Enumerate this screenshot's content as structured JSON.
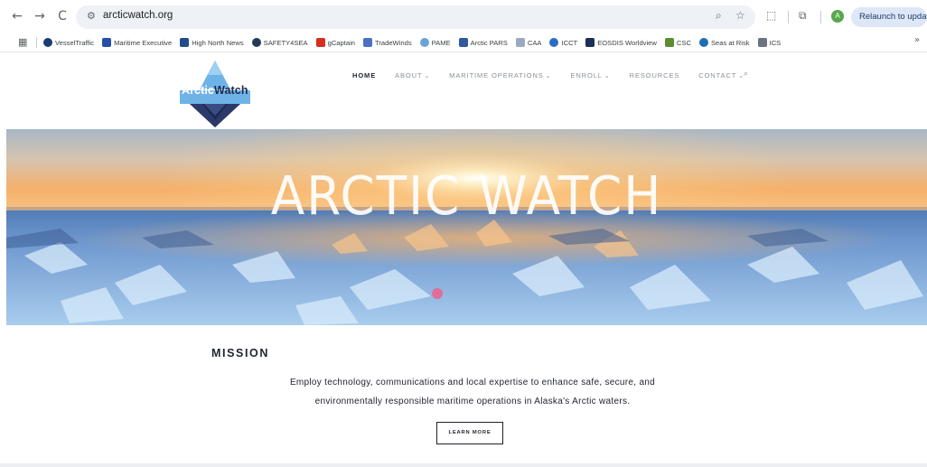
{
  "browser": {
    "nav": {
      "back": "←",
      "forward": "→",
      "reload": "C"
    },
    "site_info_icon": "tune-icon",
    "url": "arcticwatch.org",
    "toolbar_icons": [
      "zoom-icon",
      "bookmark-star-icon",
      "extensions-icon",
      "tab-search-icon"
    ],
    "avatar_letter": "A",
    "relaunch_label": "Relaunch to update",
    "bookmarks": [
      {
        "label": "VesselTraffic",
        "color": "#1d3b73"
      },
      {
        "label": "Maritime Executive",
        "color": "#2650a6"
      },
      {
        "label": "High North News",
        "color": "#1f4f86"
      },
      {
        "label": "SAFETY4SEA",
        "color": "#243b55"
      },
      {
        "label": "gCaptain",
        "color": "#d4301f"
      },
      {
        "label": "TradeWinds",
        "color": "#4a72c4"
      },
      {
        "label": "PAME",
        "color": "#6aa3d6"
      },
      {
        "label": "Arctic PARS",
        "color": "#2f5a9e"
      },
      {
        "label": "CAA",
        "color": "#9aa8c2"
      },
      {
        "label": "ICCT",
        "color": "#2a6cc4"
      },
      {
        "label": "EOSDIS Worldview",
        "color": "#1b2f57"
      },
      {
        "label": "CSC",
        "color": "#5e8c32"
      },
      {
        "label": "Seas at Risk",
        "color": "#1b6fb5"
      },
      {
        "label": "ICS",
        "color": "#6b7280"
      }
    ],
    "bookmarks_more": "»"
  },
  "site": {
    "logo_text_arctic": "Arctic",
    "logo_text_watch": "Watch",
    "nav": [
      {
        "label": "HOME",
        "active": true,
        "dropdown": false
      },
      {
        "label": "ABOUT",
        "active": false,
        "dropdown": true
      },
      {
        "label": "MARITIME OPERATIONS",
        "active": false,
        "dropdown": true
      },
      {
        "label": "ENROLL",
        "active": false,
        "dropdown": true
      },
      {
        "label": "RESOURCES",
        "active": false,
        "dropdown": false
      },
      {
        "label": "CONTACT",
        "active": false,
        "dropdown": true
      }
    ],
    "hero_title": "ARCTIC WATCH",
    "mission": {
      "title": "MISSION",
      "line1": "Employ technology, communications and local expertise to enhance safe, secure, and",
      "line2": "environmentally responsible maritime operations in Alaska's Arctic waters.",
      "button": "LEARN MORE"
    }
  },
  "colors": {
    "brand_navy": "#1d2a52",
    "brand_light_blue": "#6fb3e6",
    "sky_top": "#b9c8d6",
    "sky_glow": "#f3a860",
    "ice": "#9ec6e8"
  }
}
